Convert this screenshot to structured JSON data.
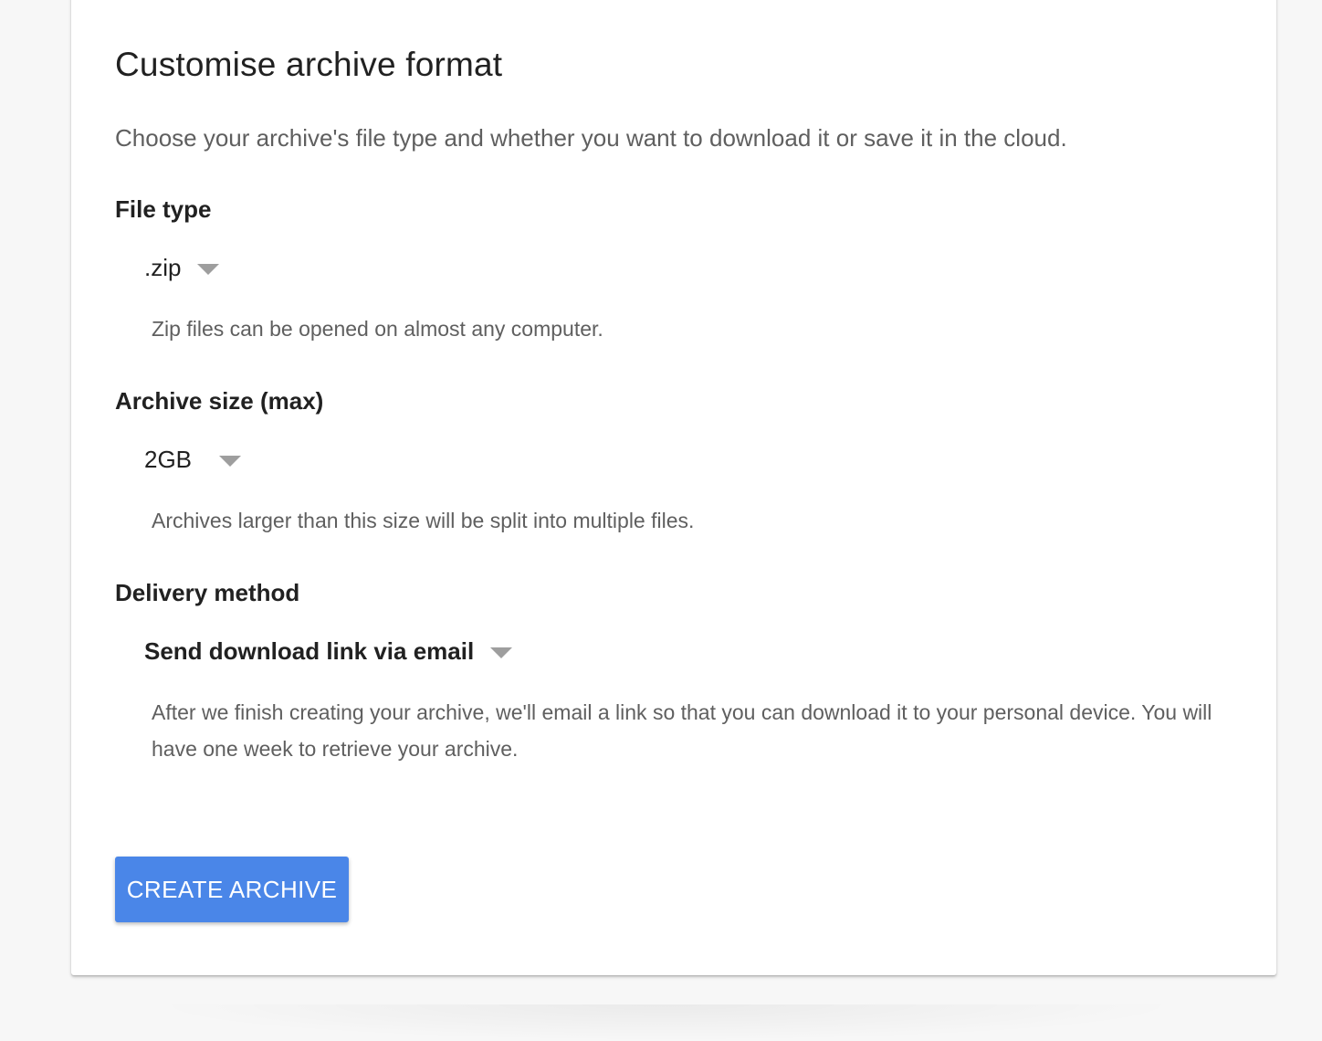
{
  "page": {
    "title": "Customise archive format",
    "subtitle": "Choose your archive's file type and whether you want to download it or save it in the cloud."
  },
  "file_type": {
    "heading": "File type",
    "selected": ".zip",
    "helper": "Zip files can be opened on almost any computer."
  },
  "archive_size": {
    "heading": "Archive size (max)",
    "selected": "2GB",
    "helper": "Archives larger than this size will be split into multiple files."
  },
  "delivery_method": {
    "heading": "Delivery method",
    "selected": "Send download link via email",
    "helper": "After we finish creating your archive, we'll email a link so that you can download it to your personal device. You will have one week to retrieve your archive."
  },
  "actions": {
    "create_label": "CREATE ARCHIVE"
  },
  "colors": {
    "primary": "#4a86e8",
    "heading_text": "#212121",
    "secondary_text": "#5f5f5f",
    "caret": "#9e9e9e",
    "page_background": "#f7f7f7"
  },
  "icons": {
    "dropdown": "caret-down-icon"
  }
}
